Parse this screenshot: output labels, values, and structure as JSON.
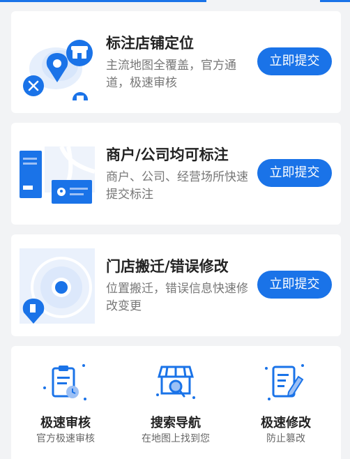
{
  "services": [
    {
      "title": "标注店铺定位",
      "desc": "主流地图全覆盖，官方通道，极速审核",
      "button": "立即提交",
      "icon": "map-pin-store-icon"
    },
    {
      "title": "商户/公司均可标注",
      "desc": "商户、公司、经营场所快速提交标注",
      "button": "立即提交",
      "icon": "merchant-card-icon"
    },
    {
      "title": "门店搬迁/错误修改",
      "desc": "位置搬迁，错误信息快速修改变更",
      "button": "立即提交",
      "icon": "relocate-pin-icon"
    }
  ],
  "features": [
    {
      "title": "极速审核",
      "sub": "官方极速审核",
      "icon": "clipboard-clock-icon"
    },
    {
      "title": "搜索导航",
      "sub": "在地图上找到您",
      "icon": "store-search-icon"
    },
    {
      "title": "极速修改",
      "sub": "防止篡改",
      "icon": "edit-document-icon"
    }
  ],
  "colors": {
    "accent": "#1a73e8",
    "background": "#f2f3f5"
  }
}
